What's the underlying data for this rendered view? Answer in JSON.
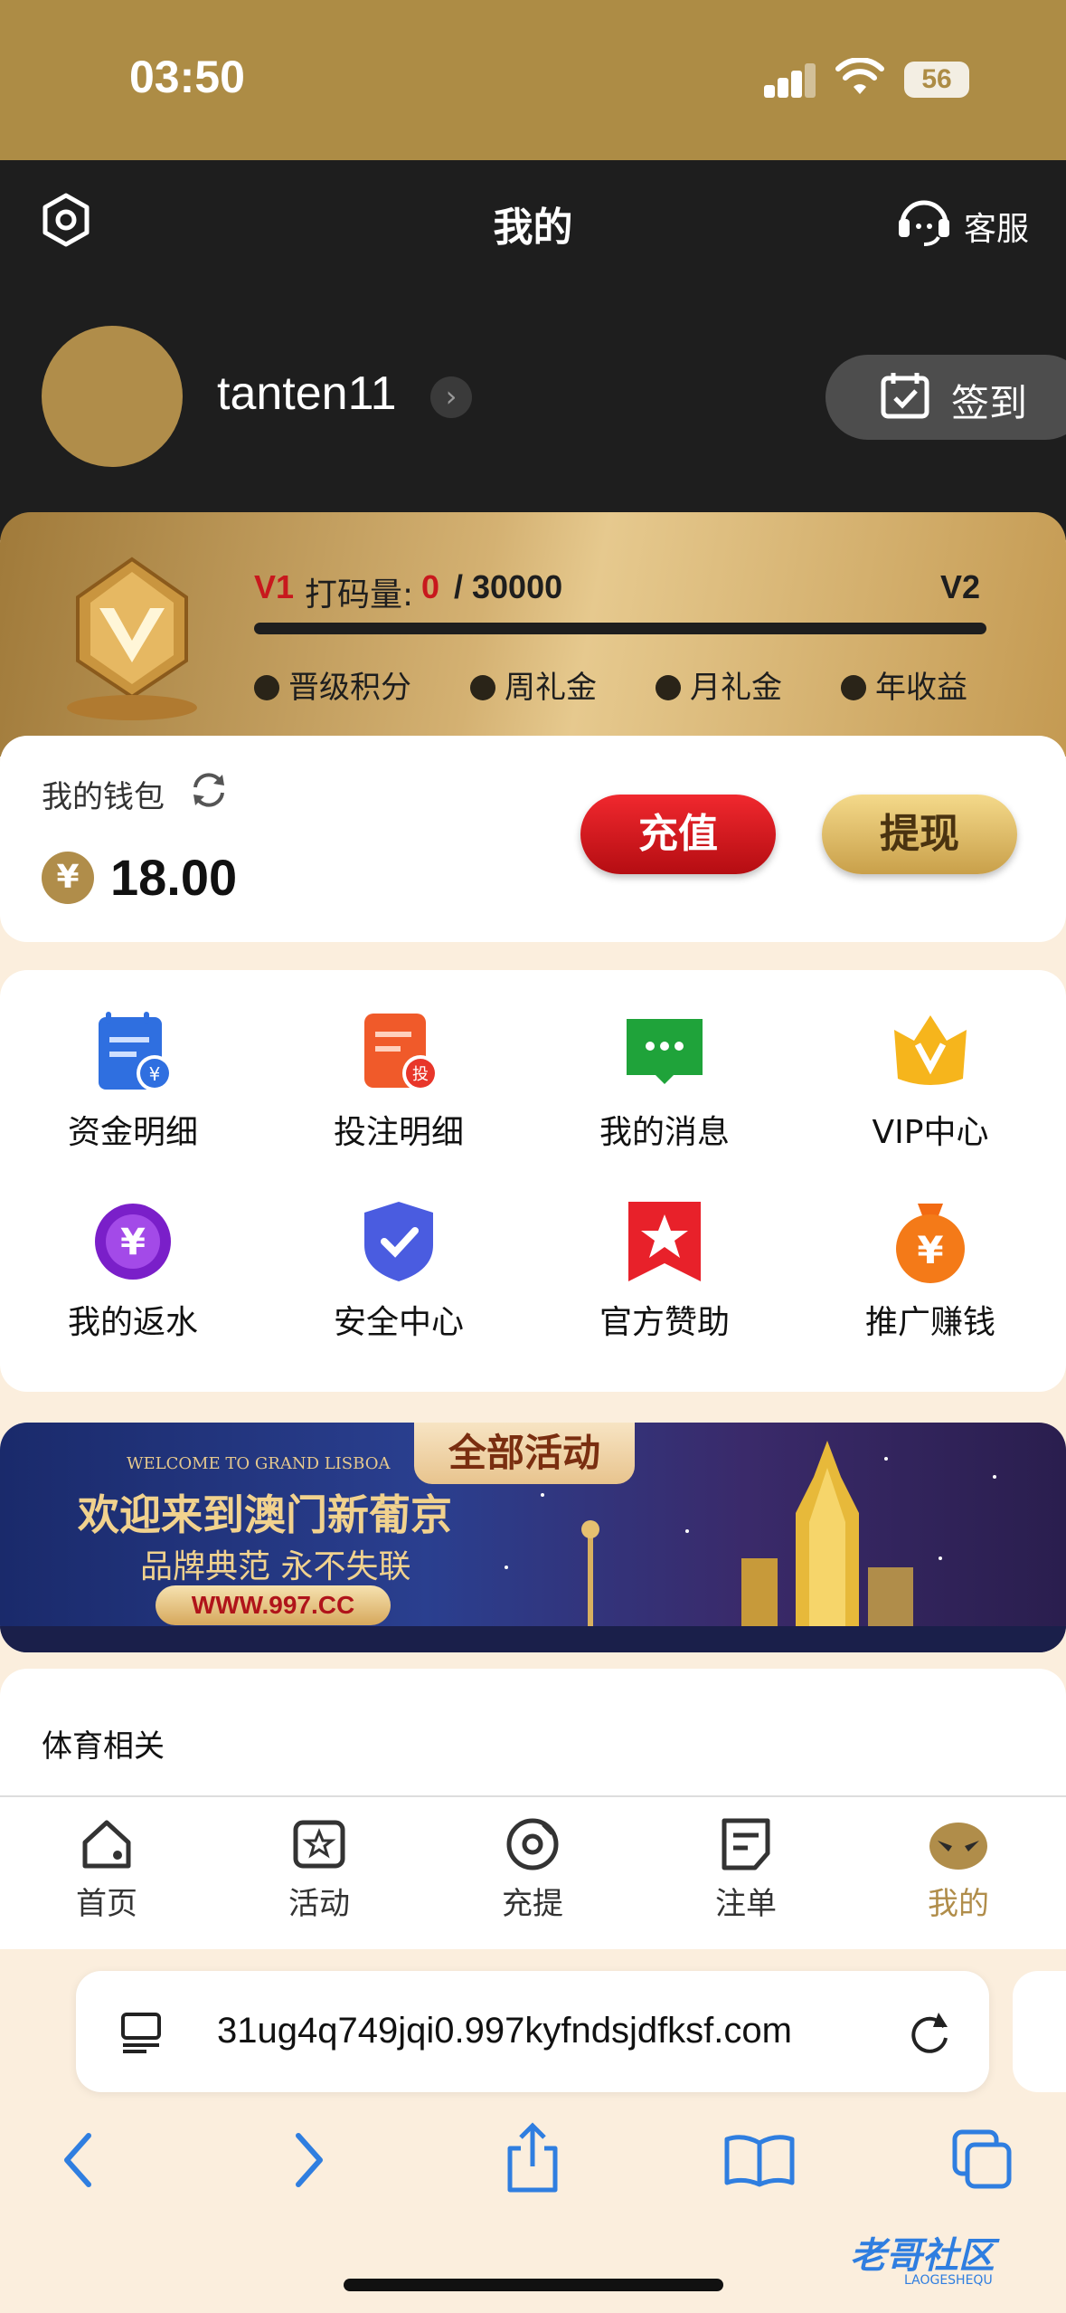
{
  "status_bar": {
    "time": "03:50",
    "battery": "56"
  },
  "header": {
    "title": "我的",
    "service_label": "客服"
  },
  "user": {
    "username": "tanten11",
    "checkin_label": "签到"
  },
  "vip": {
    "current_level": "V1",
    "wager_label": "打码量:",
    "wager_current": "0",
    "wager_total": "/ 30000",
    "next_level": "V2",
    "progress": 0,
    "perks": [
      "晋级积分",
      "周礼金",
      "月礼金",
      "年收益"
    ]
  },
  "wallet": {
    "label": "我的钱包",
    "currency_symbol": "¥",
    "balance": "18.00",
    "recharge_label": "充值",
    "withdraw_label": "提现"
  },
  "menu": [
    {
      "label": "资金明细",
      "icon": "fund-detail-icon"
    },
    {
      "label": "投注明细",
      "icon": "bet-detail-icon"
    },
    {
      "label": "我的消息",
      "icon": "message-icon"
    },
    {
      "label": "VIP中心",
      "icon": "vip-crown-icon"
    },
    {
      "label": "我的返水",
      "icon": "rebate-icon"
    },
    {
      "label": "安全中心",
      "icon": "shield-icon"
    },
    {
      "label": "官方赞助",
      "icon": "star-ribbon-icon"
    },
    {
      "label": "推广赚钱",
      "icon": "money-bag-icon"
    }
  ],
  "banner": {
    "tab_label": "全部活动",
    "welcome": "WELCOME TO GRAND LISBOA",
    "headline": "欢迎来到澳门新葡京",
    "subline": "品牌典范  永不失联",
    "url": "WWW.997.CC"
  },
  "sports": {
    "title": "体育相关"
  },
  "tabbar": [
    {
      "label": "首页",
      "icon": "home-icon"
    },
    {
      "label": "活动",
      "icon": "activity-icon"
    },
    {
      "label": "充提",
      "icon": "deposit-icon"
    },
    {
      "label": "注单",
      "icon": "order-icon"
    },
    {
      "label": "我的",
      "icon": "mine-mask-icon"
    }
  ],
  "browser": {
    "url": "31ug4q749jqi0.997kyfndsjdfksf.com"
  },
  "watermark": {
    "title": "老哥社区",
    "subtitle": "LAOGESHEQU"
  },
  "colors": {
    "gold": "#ad8c45",
    "dark": "#1e1e1e",
    "red": "#c8181d",
    "active_tab": "#b08d4a"
  }
}
